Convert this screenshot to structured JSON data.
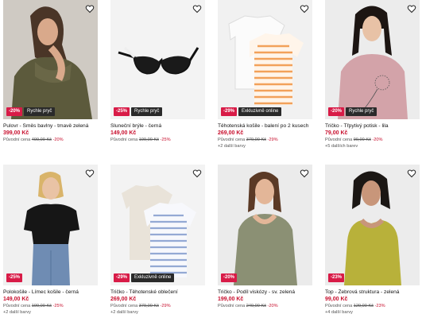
{
  "products": [
    {
      "name": "Pulovr - Směs bavlny - tmavě zelená",
      "price": "399,00 Kč",
      "orig_label": "Původní cena",
      "orig_price": "499,00 Kč",
      "discount": "-20%",
      "badge_discount": "-20%",
      "badge_tag": "Rychle pryč",
      "more_colors": ""
    },
    {
      "name": "Sluneční brýle - černá",
      "price": "149,00 Kč",
      "orig_label": "Původní cena",
      "orig_price": "199,00 Kč",
      "discount": "-25%",
      "badge_discount": "-25%",
      "badge_tag": "Rychle pryč",
      "more_colors": ""
    },
    {
      "name": "Těhotenská košile - balení po 2 kusech",
      "price": "269,00 Kč",
      "orig_label": "Původní cena",
      "orig_price": "379,00 Kč",
      "discount": "-29%",
      "badge_discount": "-29%",
      "badge_tag": "Exkluzivně online",
      "more_colors": "+2 další barvy"
    },
    {
      "name": "Tričko - Třpytivý potisk - lila",
      "price": "79,00 Kč",
      "orig_label": "Původní cena",
      "orig_price": "99,00 Kč",
      "discount": "-20%",
      "badge_discount": "-20%",
      "badge_tag": "Rychle pryč",
      "more_colors": "+5 dalších barev"
    },
    {
      "name": "Polokošile - Límec košile - černá",
      "price": "149,00 Kč",
      "orig_label": "Původní cena",
      "orig_price": "199,00 Kč",
      "discount": "-25%",
      "badge_discount": "-25%",
      "badge_tag": "",
      "more_colors": "+2 další barvy"
    },
    {
      "name": "Tričko - Těhotenské oblečení",
      "price": "269,00 Kč",
      "orig_label": "Původní cena",
      "orig_price": "379,00 Kč",
      "discount": "-29%",
      "badge_discount": "-29%",
      "badge_tag": "Exkluzivně online",
      "more_colors": "+2 další barvy"
    },
    {
      "name": "Tričko - Podíl viskózy - sv. zelená",
      "price": "199,00 Kč",
      "orig_label": "Původní cena",
      "orig_price": "249,00 Kč",
      "discount": "-20%",
      "badge_discount": "-20%",
      "badge_tag": "",
      "more_colors": ""
    },
    {
      "name": "Top - Žebrová struktura - zelená",
      "price": "99,00 Kč",
      "orig_label": "Původní cena",
      "orig_price": "129,00 Kč",
      "discount": "-23%",
      "badge_discount": "-23%",
      "badge_tag": "",
      "more_colors": "+4 další barvy"
    }
  ],
  "icons": {
    "favorite": "heart-icon"
  },
  "colors": {
    "discount_red": "#c8102e",
    "badge_red": "#d81b47",
    "tag_dark": "#2a2a2a"
  }
}
